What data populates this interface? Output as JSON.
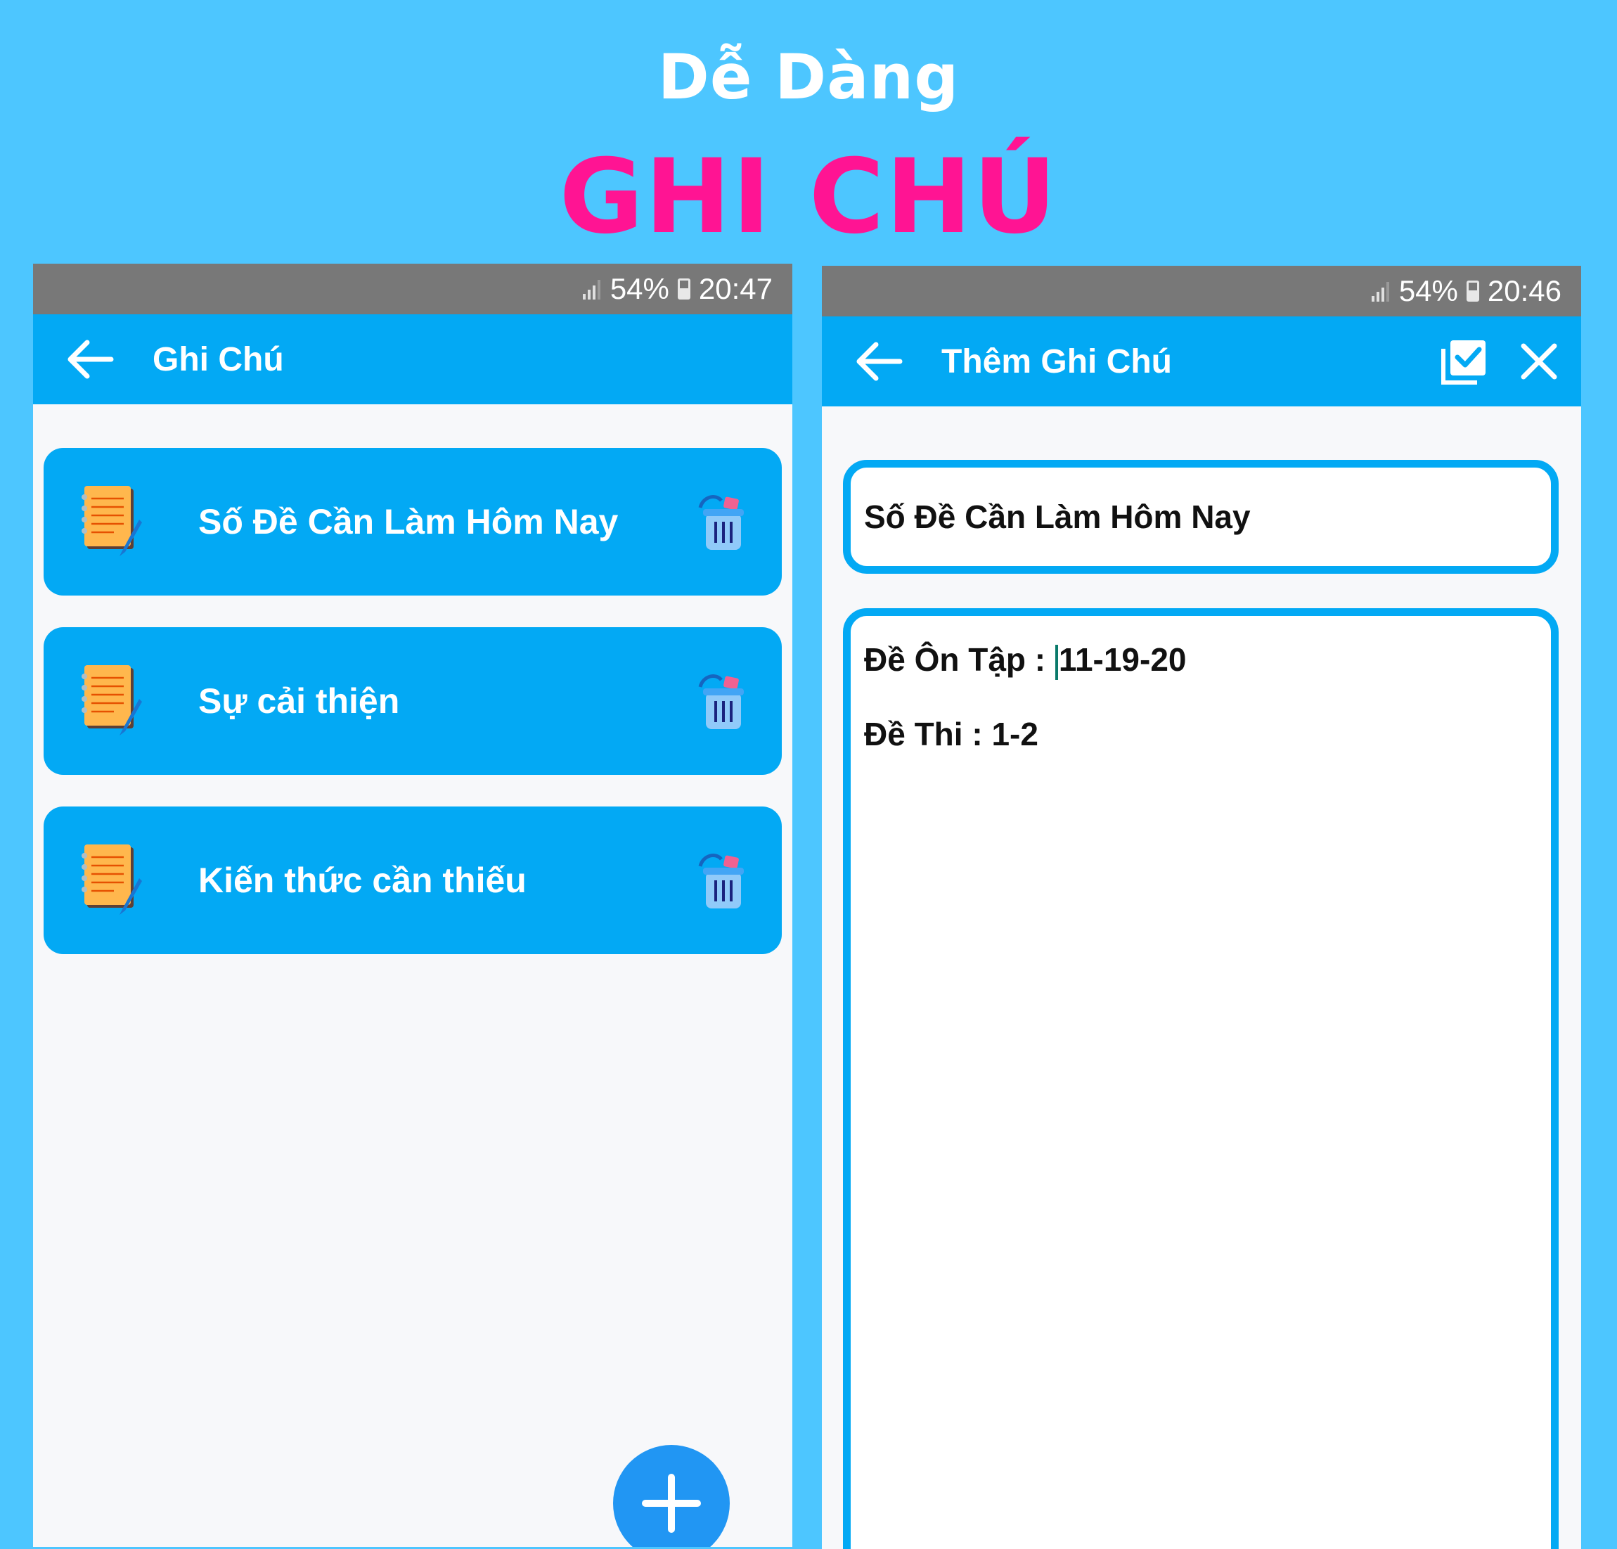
{
  "promo": {
    "headline_top": "Dễ Dàng",
    "headline_main": "GHI CHÚ"
  },
  "left_screen": {
    "status": {
      "battery": "54%",
      "time": "20:47"
    },
    "app_bar": {
      "title": "Ghi Chú"
    },
    "notes": [
      {
        "title": "Số Đề Cần Làm Hôm Nay"
      },
      {
        "title": "Sự cải thiện"
      },
      {
        "title": "Kiến thức cần thiếu"
      }
    ]
  },
  "right_screen": {
    "status": {
      "battery": "54%",
      "time": "20:46"
    },
    "app_bar": {
      "title": "Thêm Ghi Chú"
    },
    "title_field": {
      "value": "Số Đề Cần Làm Hôm Nay"
    },
    "body_field": {
      "line1_before_cursor": "Đề Ôn Tập : ",
      "line1_after_cursor": "11-19-20",
      "line2": "Đề Thi : 1-2"
    }
  },
  "colors": {
    "background": "#4dc6ff",
    "app_bar": "#03a9f4",
    "headline_main": "#ff1493",
    "status_bar": "#787878",
    "fab": "#2196f3"
  },
  "icons": [
    "arrow-back-icon",
    "notepad-icon",
    "trash-icon",
    "plus-icon",
    "save-check-icon",
    "close-icon",
    "signal-icon",
    "battery-icon"
  ]
}
